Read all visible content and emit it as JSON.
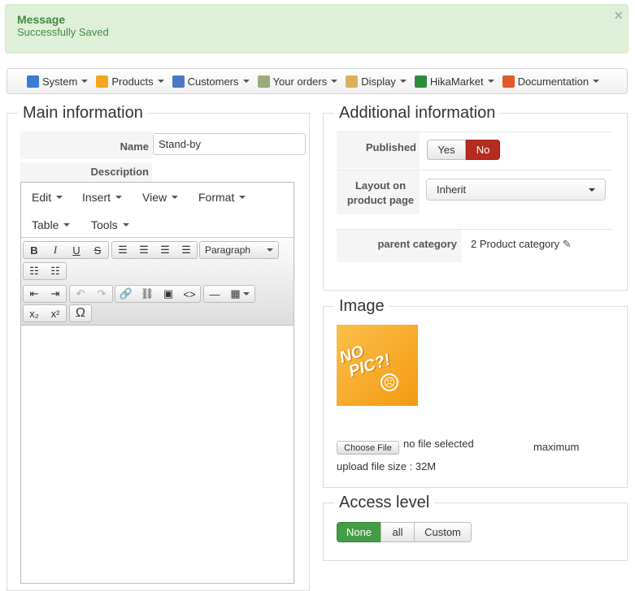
{
  "message": {
    "title": "Message",
    "text": "Successfully Saved",
    "close": "×"
  },
  "menu": [
    {
      "label": "System",
      "icon": "tools-icon",
      "color": "#3a7bd5"
    },
    {
      "label": "Products",
      "icon": "box-icon",
      "color": "#f5a623"
    },
    {
      "label": "Customers",
      "icon": "users-icon",
      "color": "#4a78c2"
    },
    {
      "label": "Your orders",
      "icon": "orders-icon",
      "color": "#9aaa7a"
    },
    {
      "label": "Display",
      "icon": "display-icon",
      "color": "#d9b25a"
    },
    {
      "label": "HikaMarket",
      "icon": "hikamarket-icon",
      "color": "#2e8b3c"
    },
    {
      "label": "Documentation",
      "icon": "lifebuoy-icon",
      "color": "#e05a2a"
    }
  ],
  "main": {
    "legend": "Main information",
    "name_label": "Name",
    "name_value": "Stand-by",
    "description_label": "Description",
    "editor": {
      "menus": [
        "Edit",
        "Insert",
        "View",
        "Format",
        "Table",
        "Tools"
      ],
      "format_select": "Paragraph"
    }
  },
  "additional": {
    "legend": "Additional information",
    "published_label": "Published",
    "yes": "Yes",
    "no": "No",
    "layout_label": "Layout on product page",
    "layout_value": "Inherit",
    "parent_label": "parent category",
    "parent_value": "2 Product category"
  },
  "image": {
    "legend": "Image",
    "placeholder_text": "NO PIC?!",
    "choose": "Choose File",
    "no_file": "no file selected",
    "max1": "maximum",
    "max2": "upload file size : 32M"
  },
  "access": {
    "legend": "Access level",
    "options": [
      "None",
      "all",
      "Custom"
    ],
    "selected": "None"
  },
  "colors": {
    "green": "#449d44",
    "red": "#b52b1e",
    "orange": "#f7a21c"
  }
}
